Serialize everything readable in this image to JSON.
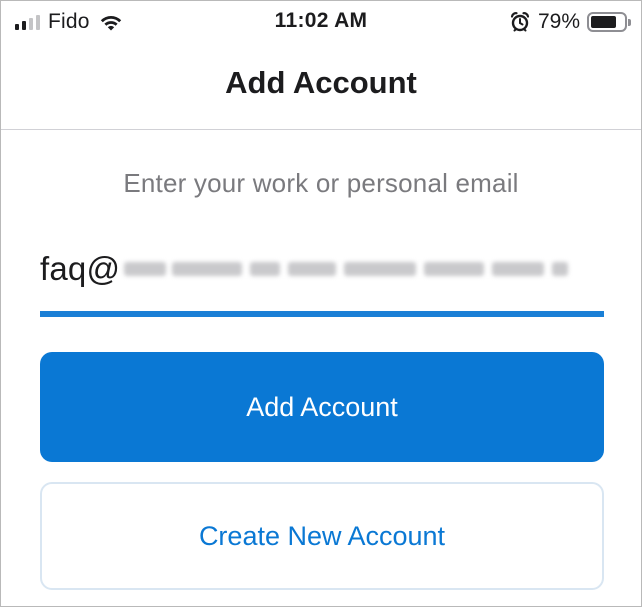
{
  "status_bar": {
    "carrier": "Fido",
    "time": "11:02 AM",
    "battery_percent": "79%",
    "battery_level": 0.79,
    "signal_bars_active": 2,
    "signal_bars_total": 4,
    "icons": [
      "signal-icon",
      "wifi-icon",
      "alarm-icon",
      "battery-icon"
    ]
  },
  "nav": {
    "title": "Add Account"
  },
  "form": {
    "prompt": "Enter your work or personal email",
    "email_visible_prefix": "faq@",
    "email_rest_redacted": true
  },
  "buttons": {
    "add_account": "Add Account",
    "create_new_account": "Create New Account"
  },
  "colors": {
    "accent": "#0a78d4",
    "underline": "#1a7fd6",
    "secondary_border": "#d9e6f2",
    "prompt_text": "#7a7a7e"
  }
}
